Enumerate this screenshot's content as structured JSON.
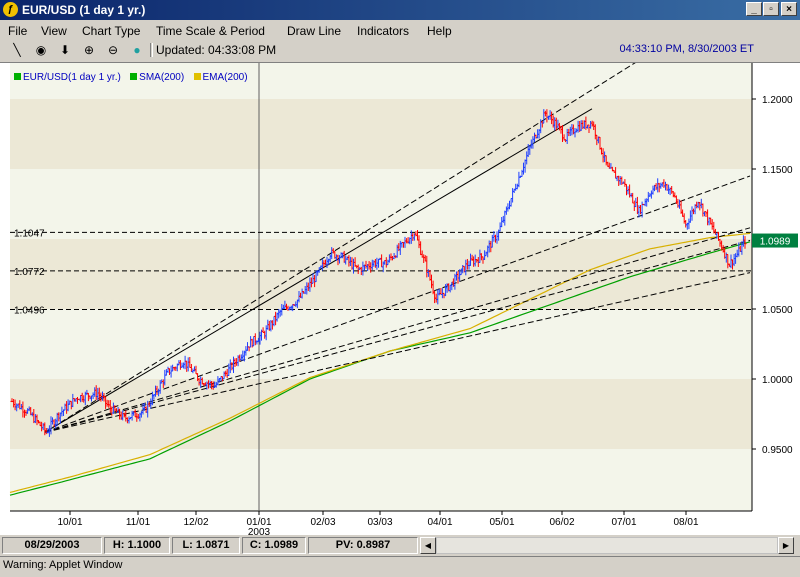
{
  "window": {
    "title": "EUR/USD (1 day  1 yr.)",
    "minimize": "_",
    "restore": "▫",
    "close": "×"
  },
  "menu": [
    "File",
    "View",
    "Chart Type",
    "Time Scale & Period",
    "Draw Line",
    "Indicators",
    "Help"
  ],
  "toolbar": {
    "updated": "Updated: 04:33:08 PM",
    "clock": "04:33:10 PM, 8/30/2003 ET"
  },
  "legend": [
    {
      "name": "EUR/USD(1 day  1 yr.)",
      "color": "#00b000"
    },
    {
      "name": "SMA(200)",
      "color": "#00b000"
    },
    {
      "name": "EMA(200)",
      "color": "#e0c000"
    }
  ],
  "colors": {
    "up": "#2040ff",
    "down": "#ff0000",
    "sma": "#00a000",
    "ema": "#d8b000",
    "lastPrice": "#008040"
  },
  "chart_data": {
    "type": "candlestick",
    "yticks": [
      "1.2000",
      "1.1500",
      "1.1000",
      "1.0500",
      "1.0000",
      "0.9500"
    ],
    "xticks": [
      "10/01",
      "11/01",
      "12/02",
      "01/01",
      "02/03",
      "03/03",
      "04/01",
      "05/01",
      "06/02",
      "07/01",
      "08/01"
    ],
    "year_label": "2003",
    "ylim": [
      0.92,
      1.22
    ],
    "last_price": "1.0989",
    "h_levels": [
      {
        "label": "1.1047",
        "value": 1.1047
      },
      {
        "label": "1.0772",
        "value": 1.0772
      },
      {
        "label": "1.0496",
        "value": 1.0496
      }
    ],
    "anchors": {
      "close": [
        [
          0,
          0.984
        ],
        [
          10,
          0.977
        ],
        [
          22,
          0.962
        ],
        [
          30,
          0.975
        ],
        [
          42,
          0.987
        ],
        [
          55,
          0.99
        ],
        [
          62,
          0.98
        ],
        [
          72,
          0.972
        ],
        [
          85,
          0.977
        ],
        [
          100,
          1.005
        ],
        [
          110,
          1.013
        ],
        [
          120,
          1.0
        ],
        [
          130,
          0.995
        ],
        [
          140,
          1.008
        ],
        [
          152,
          1.025
        ],
        [
          162,
          1.033
        ],
        [
          172,
          1.048
        ],
        [
          184,
          1.057
        ],
        [
          196,
          1.075
        ],
        [
          204,
          1.09
        ],
        [
          212,
          1.087
        ],
        [
          222,
          1.078
        ],
        [
          232,
          1.083
        ],
        [
          240,
          1.083
        ],
        [
          250,
          1.095
        ],
        [
          258,
          1.105
        ],
        [
          265,
          1.082
        ],
        [
          272,
          1.057
        ],
        [
          282,
          1.068
        ],
        [
          292,
          1.082
        ],
        [
          302,
          1.088
        ],
        [
          312,
          1.105
        ],
        [
          322,
          1.135
        ],
        [
          332,
          1.165
        ],
        [
          342,
          1.19
        ],
        [
          348,
          1.183
        ],
        [
          355,
          1.172
        ],
        [
          362,
          1.18
        ],
        [
          372,
          1.183
        ],
        [
          382,
          1.15
        ],
        [
          392,
          1.14
        ],
        [
          402,
          1.12
        ],
        [
          410,
          1.135
        ],
        [
          418,
          1.14
        ],
        [
          425,
          1.13
        ],
        [
          432,
          1.11
        ],
        [
          440,
          1.128
        ],
        [
          448,
          1.11
        ],
        [
          455,
          1.095
        ],
        [
          460,
          1.082
        ],
        [
          465,
          1.089
        ],
        [
          470,
          1.0989
        ]
      ],
      "sma": [
        [
          0,
          0.917
        ],
        [
          60,
          0.928
        ],
        [
          140,
          0.943
        ],
        [
          220,
          0.97
        ],
        [
          300,
          1.0
        ],
        [
          380,
          1.02
        ],
        [
          460,
          1.033
        ],
        [
          540,
          1.053
        ],
        [
          620,
          1.073
        ],
        [
          700,
          1.09
        ],
        [
          740,
          1.098
        ]
      ],
      "ema": [
        [
          0,
          0.919
        ],
        [
          60,
          0.93
        ],
        [
          140,
          0.946
        ],
        [
          220,
          0.972
        ],
        [
          300,
          1.001
        ],
        [
          380,
          1.02
        ],
        [
          460,
          1.036
        ],
        [
          520,
          1.057
        ],
        [
          580,
          1.078
        ],
        [
          640,
          1.093
        ],
        [
          700,
          1.101
        ],
        [
          740,
          1.104
        ]
      ]
    },
    "trend_lines": [
      {
        "from": [
          45,
          0.962
        ],
        "to": [
          592,
          1.193
        ],
        "style": "solid"
      },
      {
        "from": [
          45,
          0.962
        ],
        "to": [
          660,
          1.237
        ],
        "style": "dashed"
      },
      {
        "from": [
          45,
          0.962
        ],
        "to": [
          750,
          1.145
        ],
        "style": "dashed"
      },
      {
        "from": [
          45,
          0.962
        ],
        "to": [
          750,
          1.108
        ],
        "style": "dashed"
      },
      {
        "from": [
          45,
          0.962
        ],
        "to": [
          750,
          1.099
        ],
        "style": "dashed"
      },
      {
        "from": [
          45,
          0.962
        ],
        "to": [
          750,
          1.076
        ],
        "style": "dashed"
      }
    ],
    "date_cursor_x": 259
  },
  "status": {
    "date": "08/29/2003",
    "high": "H: 1.1000",
    "low": "L: 1.0871",
    "close": "C: 1.0989",
    "pv": "PV: 0.8987"
  },
  "warning": "Warning: Applet Window"
}
